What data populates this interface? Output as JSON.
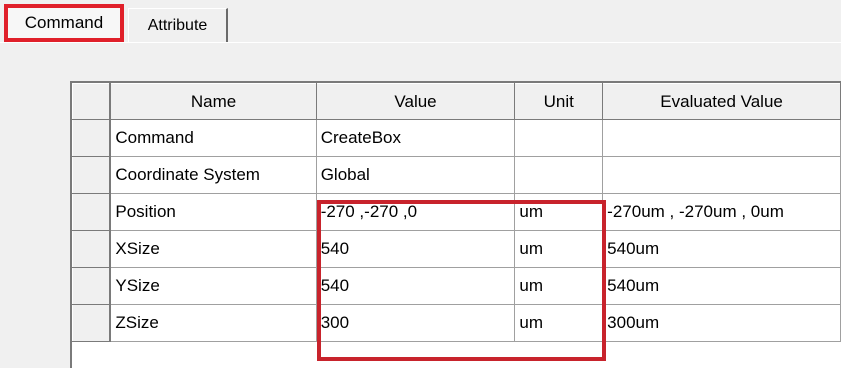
{
  "tabs": [
    {
      "label": "Command",
      "active": true
    },
    {
      "label": "Attribute",
      "active": false
    }
  ],
  "grid": {
    "columns": [
      "Name",
      "Value",
      "Unit",
      "Evaluated Value"
    ],
    "rows": [
      {
        "name": "Command",
        "value": "CreateBox",
        "unit": "",
        "evaluated": ""
      },
      {
        "name": "Coordinate System",
        "value": "Global",
        "unit": "",
        "evaluated": ""
      },
      {
        "name": "Position",
        "value": "-270 ,-270 ,0",
        "unit": "um",
        "evaluated": "-270um , -270um , 0um"
      },
      {
        "name": "XSize",
        "value": "540",
        "unit": "um",
        "evaluated": "540um"
      },
      {
        "name": "YSize",
        "value": "540",
        "unit": "um",
        "evaluated": "540um"
      },
      {
        "name": "ZSize",
        "value": "300",
        "unit": "um",
        "evaluated": "300um"
      }
    ]
  },
  "colors": {
    "tab_highlight": "#e0202a",
    "value_highlight": "#c8232c"
  }
}
